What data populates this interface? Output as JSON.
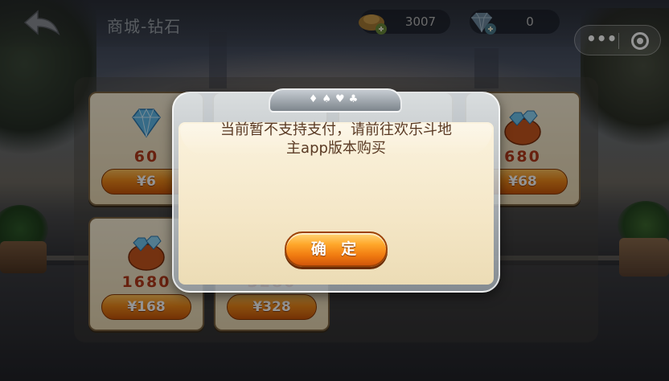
{
  "header": {
    "title": "商城-钻石",
    "gold": {
      "icon": "gold-ingot-add-icon",
      "value": "3007"
    },
    "diamond": {
      "icon": "diamond-add-icon",
      "value": "0"
    }
  },
  "miniprogram": {
    "more_icon": "more-dots-icon",
    "close_icon": "target-close-icon"
  },
  "shop": {
    "items": [
      {
        "amount": "60",
        "price": "¥6",
        "art": "diamond"
      },
      {
        "amount": "",
        "price": "",
        "art": "diamond"
      },
      {
        "amount": "",
        "price": "",
        "art": "diamond"
      },
      {
        "amount": "680",
        "price": "¥68",
        "art": "bag"
      },
      {
        "amount": "1680",
        "price": "¥168",
        "art": "bag"
      },
      {
        "amount": "3280",
        "price": "¥328",
        "art": "bag"
      }
    ]
  },
  "dialog": {
    "suits": "♦♠♥♣",
    "message_line1": "当前暂不支持支付，请前往欢乐斗地",
    "message_line2": "主app版本购买",
    "confirm_label": "确 定"
  },
  "colors": {
    "amount": "#b3391a",
    "button": "#f08a1a",
    "dialog_text": "#5a3a24"
  }
}
